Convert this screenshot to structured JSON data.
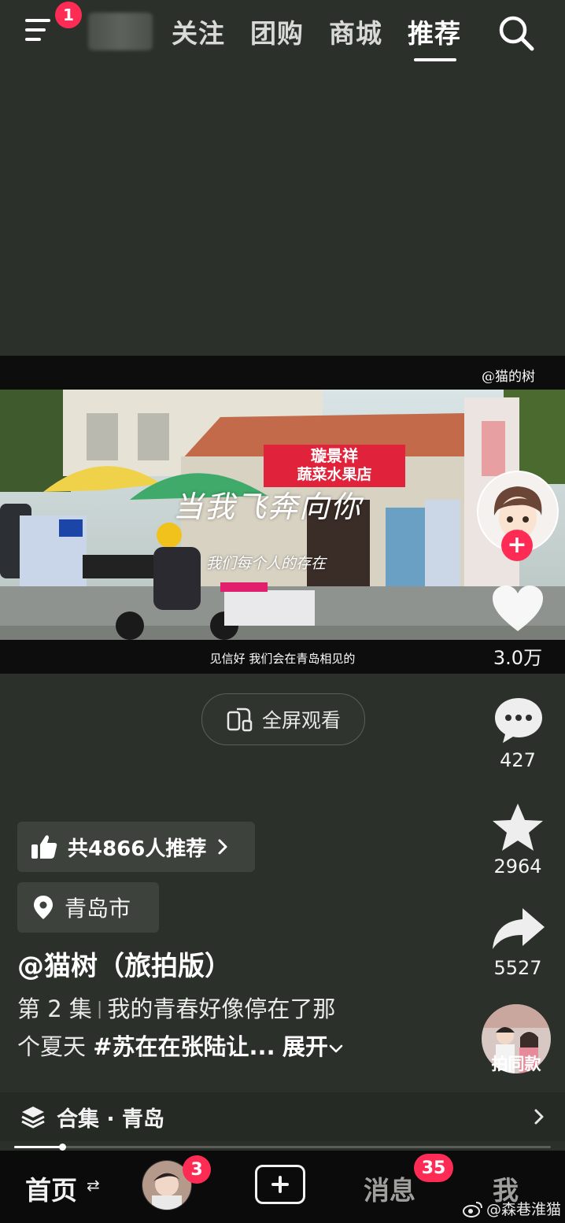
{
  "header": {
    "menu_badge": "1",
    "tabs": [
      {
        "label": "关注",
        "active": false
      },
      {
        "label": "团购",
        "active": false
      },
      {
        "label": "商城",
        "active": false
      },
      {
        "label": "推荐",
        "active": true
      }
    ]
  },
  "video": {
    "watermark": "@猫的树",
    "shop_sign_line1": "璇景祥",
    "shop_sign_line2": "蔬菜水果店",
    "overlay_title": "当我飞奔向你",
    "overlay_line": "我们每个人的存在",
    "subtitle": "见信好 我们会在青岛相见的",
    "fullscreen_label": "全屏观看"
  },
  "actions": {
    "likes": "3.0万",
    "comments": "427",
    "favorites": "2964",
    "shares": "5527",
    "same_style_label": "拍同款"
  },
  "info": {
    "recommend": "共4866人推荐",
    "location": "青岛市",
    "author": "@猫树（旅拍版）",
    "episode": "第 2 集",
    "desc_line1": "我的青春好像停在了那",
    "desc_line2_prefix": "个夏天",
    "hashtag": "#苏在在张陆让...",
    "expand": "展开"
  },
  "collection": {
    "label": "合集 · 青岛",
    "progress": 0.09
  },
  "bottom_nav": {
    "home": "首页",
    "friends_badge": "3",
    "messages": "消息",
    "messages_badge": "35",
    "me": "我"
  },
  "watermark": "@森巷淮猫",
  "colors": {
    "accent": "#fe2c55",
    "background": "#2b302a",
    "nav_background": "#0b0b0b"
  }
}
